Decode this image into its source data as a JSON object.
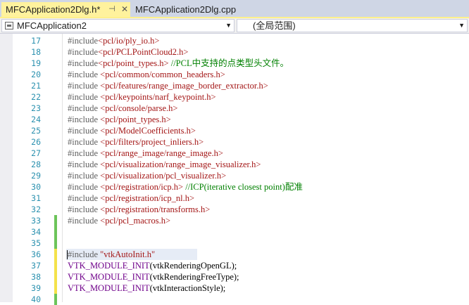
{
  "tabs": [
    {
      "label": "MFCApplication2Dlg.h*",
      "active": true
    },
    {
      "label": "MFCApplication2Dlg.cpp",
      "active": false
    }
  ],
  "icons": {
    "pin": "pin-icon",
    "close": "close-icon",
    "class": "class-icon",
    "dropdown": "chevron-down-icon"
  },
  "navbar": {
    "project_label": "MFCApplication2",
    "scope_label": "(全局范围)"
  },
  "colors": {
    "tab_active_bg": "#fff29d",
    "tabstrip_bg": "#cfd6e5",
    "line_number": "#2b91af",
    "directive": "#606060",
    "string": "#a31515",
    "comment": "#008000",
    "macro": "#6f008a",
    "change_saved": "#6cc45a",
    "change_unsaved": "#f4e24a"
  },
  "lines": [
    {
      "num": "17",
      "change": "none",
      "parts": [
        {
          "t": "#include",
          "c": "inc"
        },
        {
          "t": "<pcl/io/ply_io.h>",
          "c": "str"
        }
      ]
    },
    {
      "num": "18",
      "change": "none",
      "parts": [
        {
          "t": "#include",
          "c": "inc"
        },
        {
          "t": "<pcl/PCLPointCloud2.h>",
          "c": "str"
        }
      ]
    },
    {
      "num": "19",
      "change": "none",
      "parts": [
        {
          "t": "#include",
          "c": "inc"
        },
        {
          "t": "<pcl/point_types.h>",
          "c": "str"
        },
        {
          "t": " //PCL中支持的点类型头文件。",
          "c": "cmt"
        }
      ]
    },
    {
      "num": "20",
      "change": "none",
      "parts": [
        {
          "t": "#include ",
          "c": "inc"
        },
        {
          "t": "<pcl/common/common_headers.h>",
          "c": "str"
        }
      ]
    },
    {
      "num": "21",
      "change": "none",
      "parts": [
        {
          "t": "#include ",
          "c": "inc"
        },
        {
          "t": "<pcl/features/range_image_border_extractor.h>",
          "c": "str"
        }
      ]
    },
    {
      "num": "22",
      "change": "none",
      "parts": [
        {
          "t": "#include ",
          "c": "inc"
        },
        {
          "t": "<pcl/keypoints/narf_keypoint.h>",
          "c": "str"
        }
      ]
    },
    {
      "num": "23",
      "change": "none",
      "parts": [
        {
          "t": "#include ",
          "c": "inc"
        },
        {
          "t": "<pcl/console/parse.h>",
          "c": "str"
        }
      ]
    },
    {
      "num": "24",
      "change": "none",
      "parts": [
        {
          "t": "#include ",
          "c": "inc"
        },
        {
          "t": "<pcl/point_types.h>",
          "c": "str"
        }
      ]
    },
    {
      "num": "25",
      "change": "none",
      "parts": [
        {
          "t": "#include ",
          "c": "inc"
        },
        {
          "t": "<pcl/ModelCoefficients.h>",
          "c": "str"
        }
      ]
    },
    {
      "num": "26",
      "change": "none",
      "parts": [
        {
          "t": "#include ",
          "c": "inc"
        },
        {
          "t": "<pcl/filters/project_inliers.h>",
          "c": "str"
        }
      ]
    },
    {
      "num": "27",
      "change": "none",
      "parts": [
        {
          "t": "#include ",
          "c": "inc"
        },
        {
          "t": "<pcl/range_image/range_image.h>",
          "c": "str"
        }
      ]
    },
    {
      "num": "28",
      "change": "none",
      "parts": [
        {
          "t": "#include ",
          "c": "inc"
        },
        {
          "t": "<pcl/visualization/range_image_visualizer.h>",
          "c": "str"
        }
      ]
    },
    {
      "num": "29",
      "change": "none",
      "parts": [
        {
          "t": "#include ",
          "c": "inc"
        },
        {
          "t": "<pcl/visualization/pcl_visualizer.h>",
          "c": "str"
        }
      ]
    },
    {
      "num": "30",
      "change": "none",
      "parts": [
        {
          "t": "#include ",
          "c": "inc"
        },
        {
          "t": "<pcl/registration/icp.h>",
          "c": "str"
        },
        {
          "t": " //ICP(iterative closest point)配准",
          "c": "cmt"
        }
      ]
    },
    {
      "num": "31",
      "change": "none",
      "parts": [
        {
          "t": "#include ",
          "c": "inc"
        },
        {
          "t": "<pcl/registration/icp_nl.h>",
          "c": "str"
        }
      ]
    },
    {
      "num": "32",
      "change": "none",
      "parts": [
        {
          "t": "#include ",
          "c": "inc"
        },
        {
          "t": "<pcl/registration/transforms.h>",
          "c": "str"
        }
      ]
    },
    {
      "num": "33",
      "change": "green",
      "parts": [
        {
          "t": "#include ",
          "c": "inc"
        },
        {
          "t": "<pcl/pcl_macros.h>",
          "c": "str"
        }
      ]
    },
    {
      "num": "34",
      "change": "green",
      "parts": []
    },
    {
      "num": "35",
      "change": "green",
      "parts": []
    },
    {
      "num": "36",
      "change": "yellow",
      "current": true,
      "parts": [
        {
          "t": "#include ",
          "c": "inc"
        },
        {
          "t": "\"vtkAutoInit.h\"",
          "c": "str"
        }
      ]
    },
    {
      "num": "37",
      "change": "yellow",
      "parts": [
        {
          "t": "VTK_MODULE_INIT",
          "c": "mac"
        },
        {
          "t": "(vtkRenderingOpenGL);",
          "c": "plain"
        }
      ]
    },
    {
      "num": "38",
      "change": "yellow",
      "parts": [
        {
          "t": "VTK_MODULE_INIT",
          "c": "mac"
        },
        {
          "t": "(vtkRenderingFreeType);",
          "c": "plain"
        }
      ]
    },
    {
      "num": "39",
      "change": "yellow",
      "parts": [
        {
          "t": "VTK_MODULE_INIT",
          "c": "mac"
        },
        {
          "t": "(vtkInteractionStyle);",
          "c": "plain"
        }
      ]
    },
    {
      "num": "40",
      "change": "green",
      "parts": []
    }
  ]
}
